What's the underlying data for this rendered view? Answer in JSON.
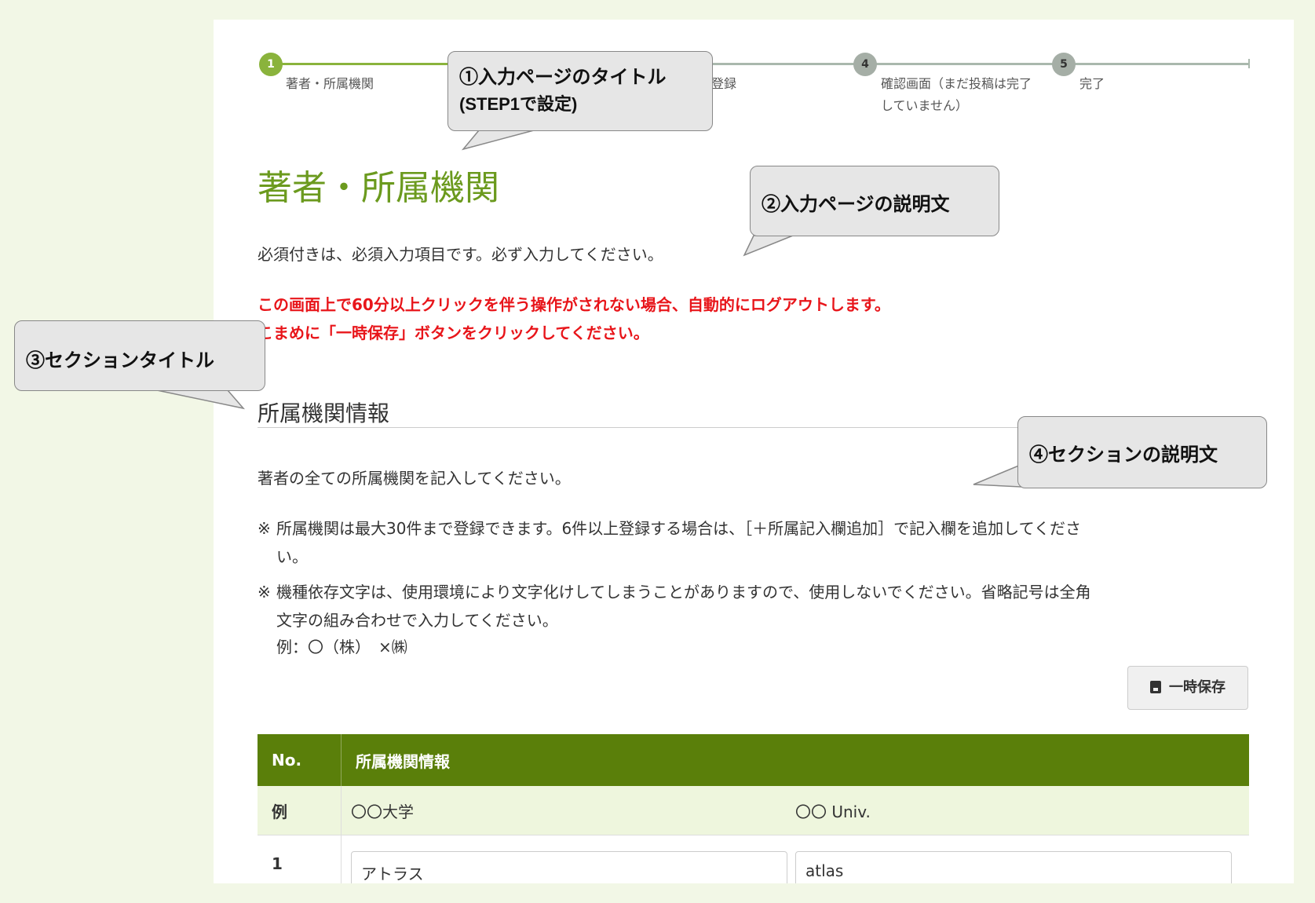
{
  "stepper": {
    "steps": [
      {
        "number": "1",
        "label": "著者・所属機関"
      },
      {
        "number": "",
        "label": "登録"
      },
      {
        "number": "4",
        "label": "確認画面（まだ投稿は完了\nしていません）"
      },
      {
        "number": "5",
        "label": "完了"
      }
    ]
  },
  "page": {
    "title": "著者・所属機関",
    "description": "必須付きは、必須入力項目です。必ず入力してください。",
    "warning_line1": "この画面上で60分以上クリックを伴う操作がされない場合、自動的にログアウトします。",
    "warning_line2": "こまめに「一時保存」ボタンをクリックしてください。"
  },
  "section": {
    "title": "所属機関情報",
    "description": "著者の全ての所属機関を記入してください。",
    "note1_line1": "所属機関は最大30件まで登録できます。6件以上登録する場合は、［＋所属記入欄追加］で記入欄を追加してくださ",
    "note1_line2": "い。",
    "note2_line1": "機種依存文字は、使用環境により文字化けしてしまうことがありますので、使用しないでください。省略記号は全角",
    "note2_line2": "文字の組み合わせで入力してください。",
    "note_mark": "※",
    "example": "例：〇（株）　×㈱"
  },
  "toolbar": {
    "save_label": "一時保存"
  },
  "table": {
    "headers": [
      "No.",
      "所属機関情報"
    ],
    "example_row": {
      "no": "例",
      "ja": "〇〇大学",
      "en": "〇〇 Univ."
    },
    "rows": [
      {
        "no": "1",
        "ja": "アトラス",
        "en": "atlas"
      }
    ]
  },
  "callouts": {
    "c1_line1": "①入力ページのタイトル",
    "c1_line2": "(STEP1で設定)",
    "c2": "②入力ページの説明文",
    "c3": "③セクションタイトル",
    "c4": "④セクションの説明文"
  },
  "colors": {
    "accent_green": "#6b9a1e",
    "header_green": "#5a7f0a",
    "warning_red": "#e8151a",
    "background": "#f2f7e6"
  }
}
